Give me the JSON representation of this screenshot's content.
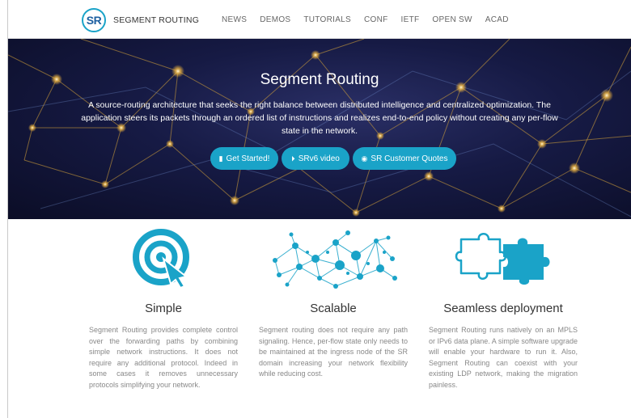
{
  "brand": {
    "logo_text": "SR",
    "name": "SEGMENT ROUTING"
  },
  "nav": [
    "NEWS",
    "DEMOS",
    "TUTORIALS",
    "CONF",
    "IETF",
    "OPEN SW",
    "ACAD"
  ],
  "hero": {
    "title": "Segment Routing",
    "subtitle": "A source-routing architecture that seeks the right balance between distributed intelligence and centralized optimization. The application steers its packets through an ordered list of instructions and realizes end-to-end policy without creating any per-flow state in the network.",
    "buttons": [
      {
        "label": "Get Started!",
        "icon": "bookmark-icon"
      },
      {
        "label": "SRv6 video",
        "icon": "play-circle-icon"
      },
      {
        "label": "SR Customer Quotes",
        "icon": "eye-icon"
      }
    ]
  },
  "features": [
    {
      "icon": "target-icon",
      "title": "Simple",
      "text": "Segment Routing provides complete control over the forwarding paths by combining simple network instructions. It does not require any additional protocol. Indeed in some cases it removes unnecessary protocols simplifying your network."
    },
    {
      "icon": "network-icon",
      "title": "Scalable",
      "text": "Segment routing does not require any path signaling. Hence, per-flow state only needs to be maintained at the ingress node of the SR domain increasing your network flexibility while reducing cost."
    },
    {
      "icon": "puzzle-icon",
      "title": "Seamless deployment",
      "text": "Segment Routing runs natively on an MPLS or IPv6 data plane. A simple software upgrade will enable your hardware to run it. Also, Segment Routing can coexist with your existing LDP network, making the migration painless."
    }
  ],
  "colors": {
    "accent": "#1aa3c8",
    "hero_bg": "#161a44",
    "network_glow": "#e8b03a"
  }
}
